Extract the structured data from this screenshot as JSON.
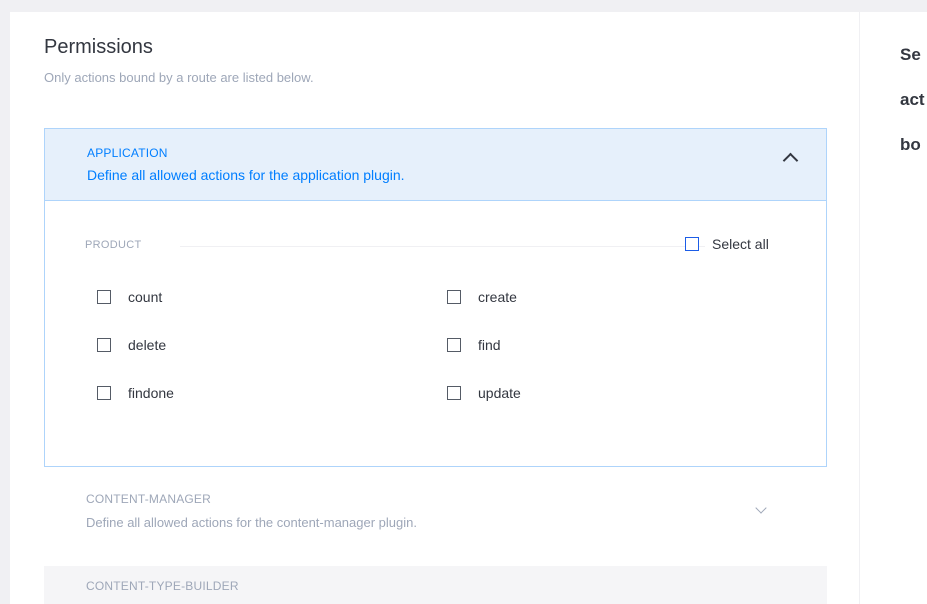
{
  "permissions": {
    "title": "Permissions",
    "subtitle": "Only actions bound by a route are listed below."
  },
  "plugins": [
    {
      "name": "APPLICATION",
      "description": "Define all allowed actions for the application plugin.",
      "expanded": true,
      "controller": {
        "name": "PRODUCT",
        "select_all_label": "Select all",
        "actions": [
          "count",
          "create",
          "delete",
          "find",
          "findone",
          "update"
        ]
      }
    },
    {
      "name": "CONTENT-MANAGER",
      "description": "Define all allowed actions for the content-manager plugin.",
      "expanded": false
    },
    {
      "name": "CONTENT-TYPE-BUILDER",
      "expanded": false
    }
  ],
  "side_panel": {
    "lines": [
      "Se",
      "act",
      "bo"
    ]
  },
  "colors": {
    "accent": "#007eff",
    "header_bg": "#e6f0fb",
    "border": "#aed4fb",
    "muted": "#9ea7b8"
  }
}
